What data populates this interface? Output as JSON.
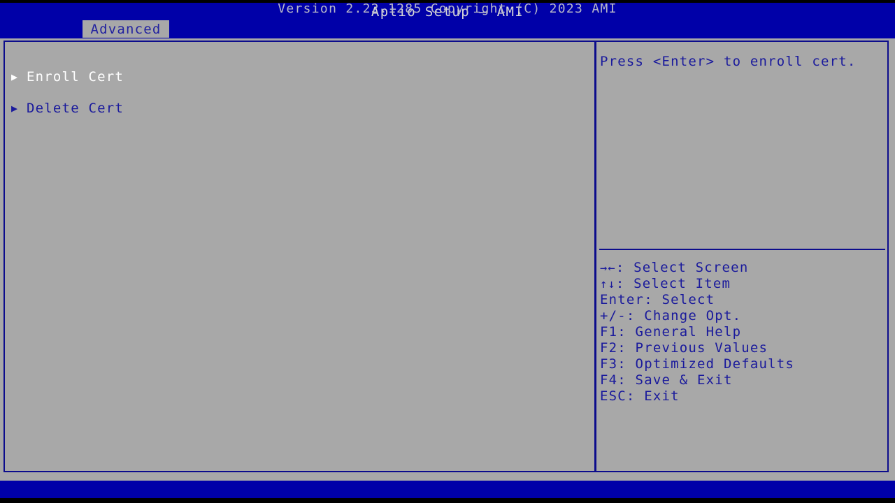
{
  "window": {
    "title": "Aptio Setup – AMI"
  },
  "tabs": [
    {
      "label": "Advanced",
      "active": true
    }
  ],
  "menu": {
    "items": [
      {
        "label": "Enroll Cert",
        "arrow": "▶",
        "selected": true
      },
      {
        "label": "Delete Cert",
        "arrow": "▶",
        "selected": false
      }
    ]
  },
  "help": {
    "text": "Press <Enter> to enroll cert."
  },
  "legend": [
    {
      "symbol": "→←",
      "text": ": Select Screen"
    },
    {
      "symbol": "↑↓",
      "text": ": Select Item"
    },
    {
      "symbol": "Enter",
      "text": ": Select"
    },
    {
      "symbol": "+/-",
      "text": ": Change Opt."
    },
    {
      "symbol": "F1",
      "text": ": General Help"
    },
    {
      "symbol": "F2",
      "text": ": Previous Values"
    },
    {
      "symbol": "F3",
      "text": ": Optimized Defaults"
    },
    {
      "symbol": "F4",
      "text": ": Save & Exit"
    },
    {
      "symbol": "ESC",
      "text": ": Exit"
    }
  ],
  "footer": {
    "text": "Version 2.22.1285 Copyright (C) 2023 AMI"
  },
  "colors": {
    "title_bar": "#0000a8",
    "body": "#a8a8a8",
    "border": "#0c0c8c",
    "text_blue": "#1a1a9c",
    "text_white": "#ffffff",
    "footer_bar": "#0000a8"
  }
}
